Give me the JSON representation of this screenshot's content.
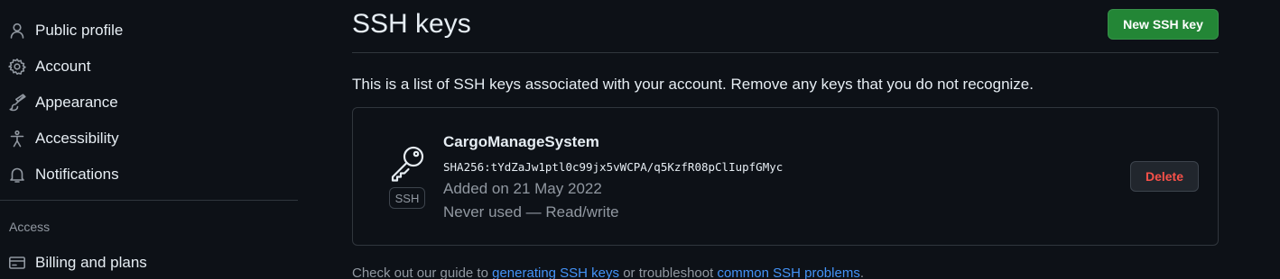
{
  "sidebar": {
    "items": [
      {
        "label": "Public profile",
        "icon": "person-icon"
      },
      {
        "label": "Account",
        "icon": "gear-icon"
      },
      {
        "label": "Appearance",
        "icon": "paintbrush-icon"
      },
      {
        "label": "Accessibility",
        "icon": "accessibility-icon"
      },
      {
        "label": "Notifications",
        "icon": "bell-icon"
      }
    ],
    "access_heading": "Access",
    "access_items": [
      {
        "label": "Billing and plans",
        "icon": "credit-card-icon"
      }
    ]
  },
  "main": {
    "title": "SSH keys",
    "new_key_label": "New SSH key",
    "description": "This is a list of SSH keys associated with your account. Remove any keys that you do not recognize.",
    "keys": [
      {
        "name": "CargoManageSystem",
        "fingerprint": "SHA256:tYdZaJw1ptl0c99jx5vWCPA/q5KzfR08pClIupfGMyc",
        "added": "Added on 21 May 2022",
        "usage": "Never used — Read/write",
        "badge": "SSH",
        "icon": "key-icon",
        "delete_label": "Delete"
      }
    ],
    "footer": {
      "prefix": "Check out our guide to ",
      "link1": "generating SSH keys",
      "middle": " or troubleshoot ",
      "link2": "common SSH problems",
      "suffix": "."
    }
  },
  "colors": {
    "background": "#0d1117",
    "primary_button": "#238636",
    "danger_text": "#f85149",
    "link": "#4493f8",
    "muted_text": "#9198a1",
    "border": "#30363d"
  }
}
